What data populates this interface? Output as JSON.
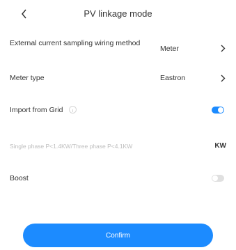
{
  "header": {
    "title": "PV linkage mode",
    "back_icon": "chevron-left-icon"
  },
  "rows": {
    "wiring": {
      "label": "External current sampling wiring method",
      "value": "Meter"
    },
    "meter_type": {
      "label": "Meter type",
      "value": "Eastron"
    },
    "import_grid": {
      "label": "Import from Grid",
      "enabled": true
    },
    "power_input": {
      "placeholder": "Single phase P<1.4KW/Three phase P<4.1KW",
      "unit": "KW"
    },
    "boost": {
      "label": "Boost",
      "enabled": false
    }
  },
  "footer": {
    "confirm_label": "Confirm"
  },
  "colors": {
    "accent": "#1c8bff",
    "toggle_on": "#1c8bff",
    "toggle_off": "#e0e0e0"
  }
}
